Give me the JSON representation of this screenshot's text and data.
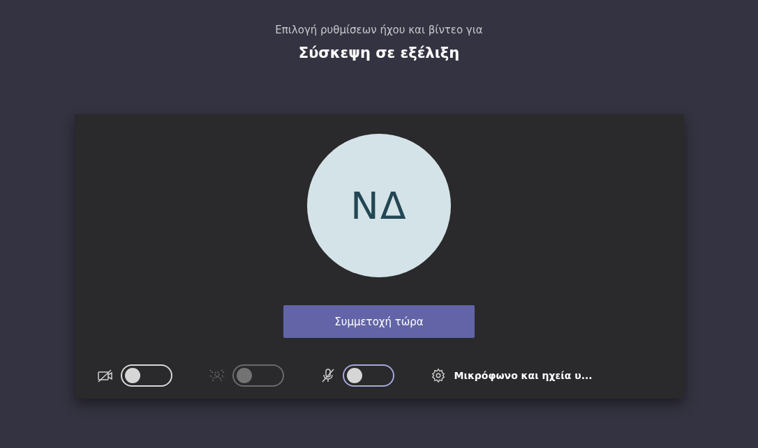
{
  "header": {
    "subtitle": "Επιλογή ρυθμίσεων ήχου και βίντεο για",
    "title": "Σύσκεψη σε εξέλιξη"
  },
  "preview": {
    "avatar_initials": "ΝΔ"
  },
  "join_button": "Συμμετοχή τώρα",
  "toggles": [
    {
      "kind": "camera",
      "on": false,
      "disabled": false,
      "focused": false
    },
    {
      "kind": "background",
      "on": false,
      "disabled": true,
      "focused": false
    },
    {
      "kind": "microphone",
      "on": false,
      "disabled": false,
      "focused": true
    }
  ],
  "device_settings": "Μικρόφωνο και ηχεία υ..."
}
